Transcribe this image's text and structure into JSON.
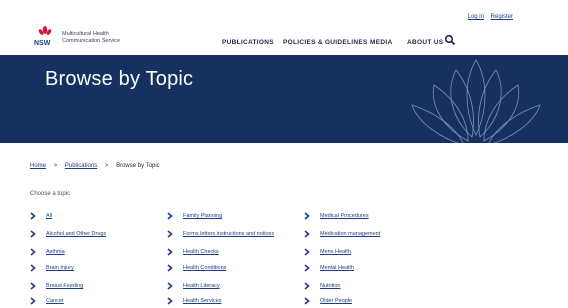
{
  "header": {
    "login_label": "Log in",
    "register_label": "Register",
    "logo_line1": "Multicultural Health",
    "logo_line2": "Communication Service",
    "logo_badge": "NSW",
    "nav": [
      {
        "label": "PUBLICATIONS"
      },
      {
        "label": "POLICIES & GUIDELINES"
      },
      {
        "label": "MEDIA"
      },
      {
        "label": "ABOUT US"
      }
    ],
    "search_icon": "search-icon"
  },
  "hero": {
    "title": "Browse by Topic"
  },
  "breadcrumb": {
    "home": "Home",
    "sep1": ">",
    "publications": "Publications",
    "sep2": ">",
    "current": "Browse by Topic"
  },
  "choose_label": "Choose a topic",
  "topics": {
    "col1": [
      "All",
      "Alcohol and Other Drugs",
      "Asthma",
      "Brain Injury",
      "Breast Feeding",
      "Cancer"
    ],
    "col2": [
      "Family Planning",
      "Forms letters instructions and notices",
      "Health Checks",
      "Health Conditions",
      "Health Literacy",
      "Health Services"
    ],
    "col3": [
      "Medical Procedures",
      "Medication management",
      "Mens Health",
      "Mental Health",
      "Nutrition",
      "Older People"
    ]
  },
  "colors": {
    "brand_navy": "#16315f",
    "link_blue": "#1c3e82",
    "nsw_red": "#d7153a"
  }
}
